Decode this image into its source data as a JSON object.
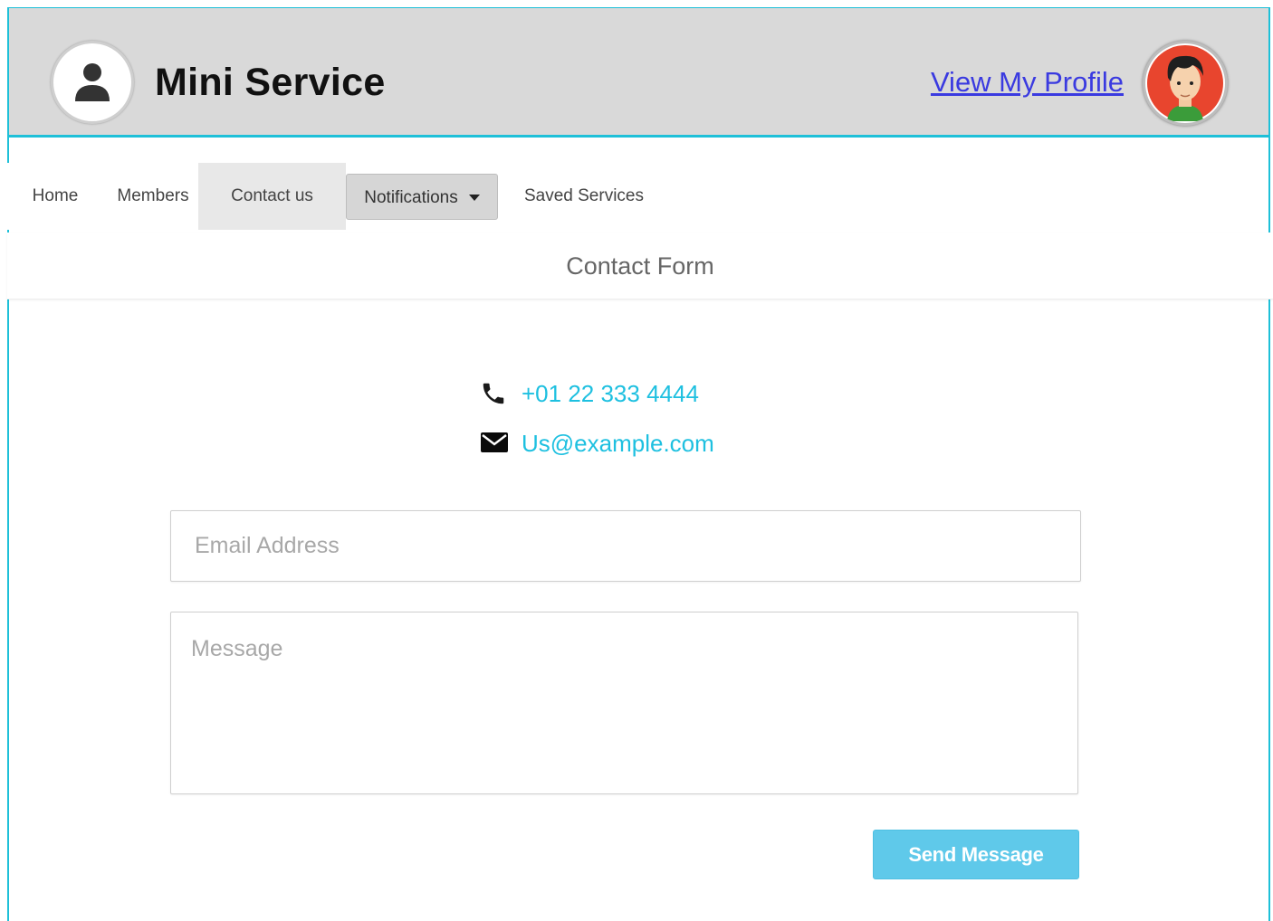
{
  "header": {
    "brand": "Mini Service",
    "profile_link": "View My Profile",
    "logo_icon": "user-silhouette-icon",
    "avatar_icon": "avatar-face-icon"
  },
  "nav": {
    "items": [
      {
        "label": "Home"
      },
      {
        "label": "Members"
      },
      {
        "label": "Contact us",
        "active": true
      },
      {
        "label": "Notifications",
        "dropdown": true
      },
      {
        "label": "Saved Services"
      }
    ]
  },
  "form": {
    "title": "Contact Form",
    "phone": "+01 22 333 4444",
    "email": "Us@example.com",
    "email_placeholder": "Email Address",
    "message_placeholder": "Message",
    "submit_label": "Send Message"
  },
  "colors": {
    "accent": "#1ec0d8",
    "link": "#3a3ae0",
    "contact_text": "#1ec0e0",
    "button": "#5fc9ea",
    "header_bg": "#d9d9d9"
  }
}
